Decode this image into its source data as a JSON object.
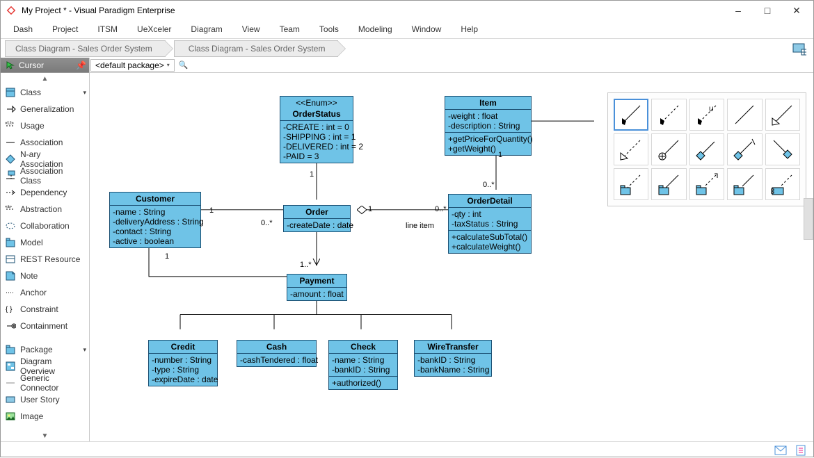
{
  "window": {
    "title": "My Project * - Visual Paradigm Enterprise"
  },
  "menu": [
    "Dash",
    "Project",
    "ITSM",
    "UeXceler",
    "Diagram",
    "View",
    "Team",
    "Tools",
    "Modeling",
    "Window",
    "Help"
  ],
  "breadcrumbs": [
    "Class Diagram - Sales Order System",
    "Class Diagram - Sales Order System"
  ],
  "package_selector": "<default package>",
  "palette_header": "Cursor",
  "palette": [
    {
      "label": "Class",
      "chev": true
    },
    {
      "label": "Generalization"
    },
    {
      "label": "Usage"
    },
    {
      "label": "Association"
    },
    {
      "label": "N-ary Association"
    },
    {
      "label": "Association Class"
    },
    {
      "label": "Dependency"
    },
    {
      "label": "Abstraction"
    },
    {
      "label": "Collaboration"
    },
    {
      "label": "Model"
    },
    {
      "label": "REST Resource"
    },
    {
      "label": "Note"
    },
    {
      "label": "Anchor"
    },
    {
      "label": "Constraint"
    },
    {
      "label": "Containment"
    }
  ],
  "palette2": [
    {
      "label": "Package",
      "chev": true
    },
    {
      "label": "Diagram Overview"
    },
    {
      "label": "Generic Connector"
    },
    {
      "label": "User Story"
    },
    {
      "label": "Image"
    }
  ],
  "uml": {
    "order_status": {
      "stereotype": "<<Enum>>",
      "name": "OrderStatus",
      "attrs": [
        "-CREATE : int = 0",
        "-SHIPPING : int = 1",
        "-DELIVERED : int = 2",
        "-PAID = 3"
      ]
    },
    "item": {
      "name": "Item",
      "attrs": [
        "-weight : float",
        "-description : String"
      ],
      "ops": [
        "+getPriceForQuantity()",
        "+getWeight()"
      ]
    },
    "customer": {
      "name": "Customer",
      "attrs": [
        "-name : String",
        "-deliveryAddress : String",
        "-contact : String",
        "-active : boolean"
      ]
    },
    "order": {
      "name": "Order",
      "attrs": [
        "-createDate : date"
      ]
    },
    "order_detail": {
      "name": "OrderDetail",
      "attrs": [
        "-qty : int",
        "-taxStatus : String"
      ],
      "ops": [
        "+calculateSubTotal()",
        "+calculateWeight()"
      ]
    },
    "payment": {
      "name": "Payment",
      "attrs": [
        "-amount : float"
      ]
    },
    "credit": {
      "name": "Credit",
      "attrs": [
        "-number : String",
        "-type : String",
        "-expireDate : date"
      ]
    },
    "cash": {
      "name": "Cash",
      "attrs": [
        "-cashTendered : float"
      ]
    },
    "check": {
      "name": "Check",
      "attrs": [
        "-name : String",
        "-bankID : String"
      ],
      "ops": [
        "+authorized()"
      ]
    },
    "wire": {
      "name": "WireTransfer",
      "attrs": [
        "-bankID : String",
        "-bankName : String"
      ]
    }
  },
  "assoc_labels": {
    "cust_order_1": "1",
    "cust_order_n": "0..*",
    "cust_below_1": "1",
    "orderstatus_1": "1",
    "order_detail_1": "1",
    "order_detail_n": "0..*",
    "order_detail_role": "line item",
    "detail_item_1": "1",
    "detail_item_n": "0..*",
    "order_payment": "1..*"
  },
  "chart_data": {
    "type": "uml-class-diagram",
    "title": "Sales Order System",
    "classes": [
      {
        "id": "OrderStatus",
        "stereotype": "Enum",
        "attrs": [
          "-CREATE : int = 0",
          "-SHIPPING : int = 1",
          "-DELIVERED : int = 2",
          "-PAID = 3"
        ],
        "ops": []
      },
      {
        "id": "Item",
        "attrs": [
          "-weight : float",
          "-description : String"
        ],
        "ops": [
          "+getPriceForQuantity()",
          "+getWeight()"
        ]
      },
      {
        "id": "Customer",
        "attrs": [
          "-name : String",
          "-deliveryAddress : String",
          "-contact : String",
          "-active : boolean"
        ],
        "ops": []
      },
      {
        "id": "Order",
        "attrs": [
          "-createDate : date"
        ],
        "ops": []
      },
      {
        "id": "OrderDetail",
        "attrs": [
          "-qty : int",
          "-taxStatus : String"
        ],
        "ops": [
          "+calculateSubTotal()",
          "+calculateWeight()"
        ]
      },
      {
        "id": "Payment",
        "attrs": [
          "-amount : float"
        ],
        "ops": []
      },
      {
        "id": "Credit",
        "attrs": [
          "-number : String",
          "-type : String",
          "-expireDate : date"
        ],
        "ops": []
      },
      {
        "id": "Cash",
        "attrs": [
          "-cashTendered : float"
        ],
        "ops": []
      },
      {
        "id": "Check",
        "attrs": [
          "-name : String",
          "-bankID : String"
        ],
        "ops": [
          "+authorized()"
        ]
      },
      {
        "id": "WireTransfer",
        "attrs": [
          "-bankID : String",
          "-bankName : String"
        ],
        "ops": []
      }
    ],
    "relations": [
      {
        "type": "association",
        "from": "Customer",
        "to": "Order",
        "from_mult": "1",
        "to_mult": "0..*"
      },
      {
        "type": "association",
        "from": "Customer",
        "to": "Payment",
        "from_mult": "1",
        "to_mult": ""
      },
      {
        "type": "association",
        "from": "OrderStatus",
        "to": "Order",
        "from_mult": "1",
        "to_mult": ""
      },
      {
        "type": "aggregation",
        "from": "Order",
        "to": "OrderDetail",
        "from_mult": "1",
        "to_mult": "0..*",
        "role_to": "line item"
      },
      {
        "type": "association",
        "from": "OrderDetail",
        "to": "Item",
        "from_mult": "0..*",
        "to_mult": "1"
      },
      {
        "type": "association",
        "from": "Order",
        "to": "Payment",
        "from_mult": "",
        "to_mult": "1..*",
        "navigable_to": true
      },
      {
        "type": "generalization",
        "from": "Credit",
        "to": "Payment"
      },
      {
        "type": "generalization",
        "from": "Cash",
        "to": "Payment"
      },
      {
        "type": "generalization",
        "from": "Check",
        "to": "Payment"
      },
      {
        "type": "generalization",
        "from": "WireTransfer",
        "to": "Payment"
      }
    ]
  }
}
